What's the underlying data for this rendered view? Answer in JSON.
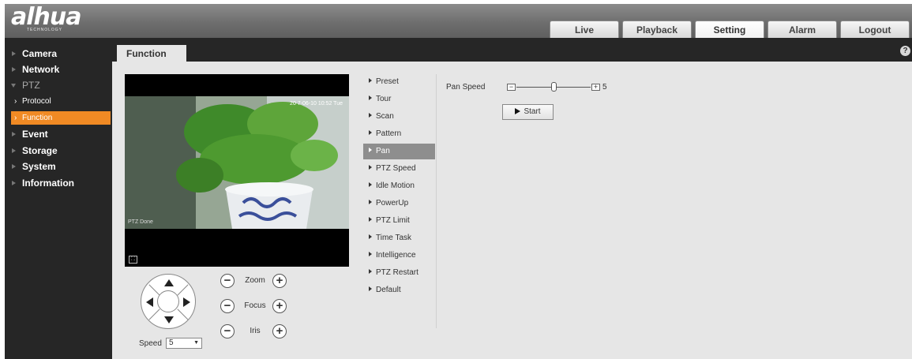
{
  "header": {
    "logo_text": "alhua",
    "logo_sub": "TECHNOLOGY",
    "tabs": [
      {
        "label": "Live"
      },
      {
        "label": "Playback"
      },
      {
        "label": "Setting"
      },
      {
        "label": "Alarm"
      },
      {
        "label": "Logout"
      }
    ],
    "active_tab": "Setting"
  },
  "sidebar": {
    "items": [
      {
        "label": "Camera"
      },
      {
        "label": "Network"
      },
      {
        "label": "PTZ"
      },
      {
        "label": "Event"
      },
      {
        "label": "Storage"
      },
      {
        "label": "System"
      },
      {
        "label": "Information"
      }
    ],
    "ptz_sub": [
      {
        "label": "Protocol"
      },
      {
        "label": "Function"
      }
    ],
    "active_item": "Function"
  },
  "content": {
    "tab_label": "Function",
    "help_symbol": "?"
  },
  "video": {
    "timestamp": "20 7-06-10 10:52 Tue",
    "status": "PTZ Done"
  },
  "ptz": {
    "zoom_label": "Zoom",
    "focus_label": "Focus",
    "iris_label": "Iris",
    "minus_symbol": "−",
    "plus_symbol": "+",
    "speed_label": "Speed",
    "speed_value": "5"
  },
  "function_menu": {
    "items": [
      {
        "label": "Preset"
      },
      {
        "label": "Tour"
      },
      {
        "label": "Scan"
      },
      {
        "label": "Pattern"
      },
      {
        "label": "Pan"
      },
      {
        "label": "PTZ Speed"
      },
      {
        "label": "Idle Motion"
      },
      {
        "label": "PowerUp"
      },
      {
        "label": "PTZ Limit"
      },
      {
        "label": "Time Task"
      },
      {
        "label": "Intelligence"
      },
      {
        "label": "PTZ Restart"
      },
      {
        "label": "Default"
      }
    ],
    "active_item": "Pan"
  },
  "pan": {
    "label": "Pan Speed",
    "value": "5",
    "level_fraction": 0.5,
    "minus_symbol": "−",
    "plus_symbol": "+",
    "start_label": "Start"
  },
  "colors": {
    "accent": "#f08a24",
    "sidebar_bg": "#262626",
    "content_bg": "#e6e6e6"
  }
}
